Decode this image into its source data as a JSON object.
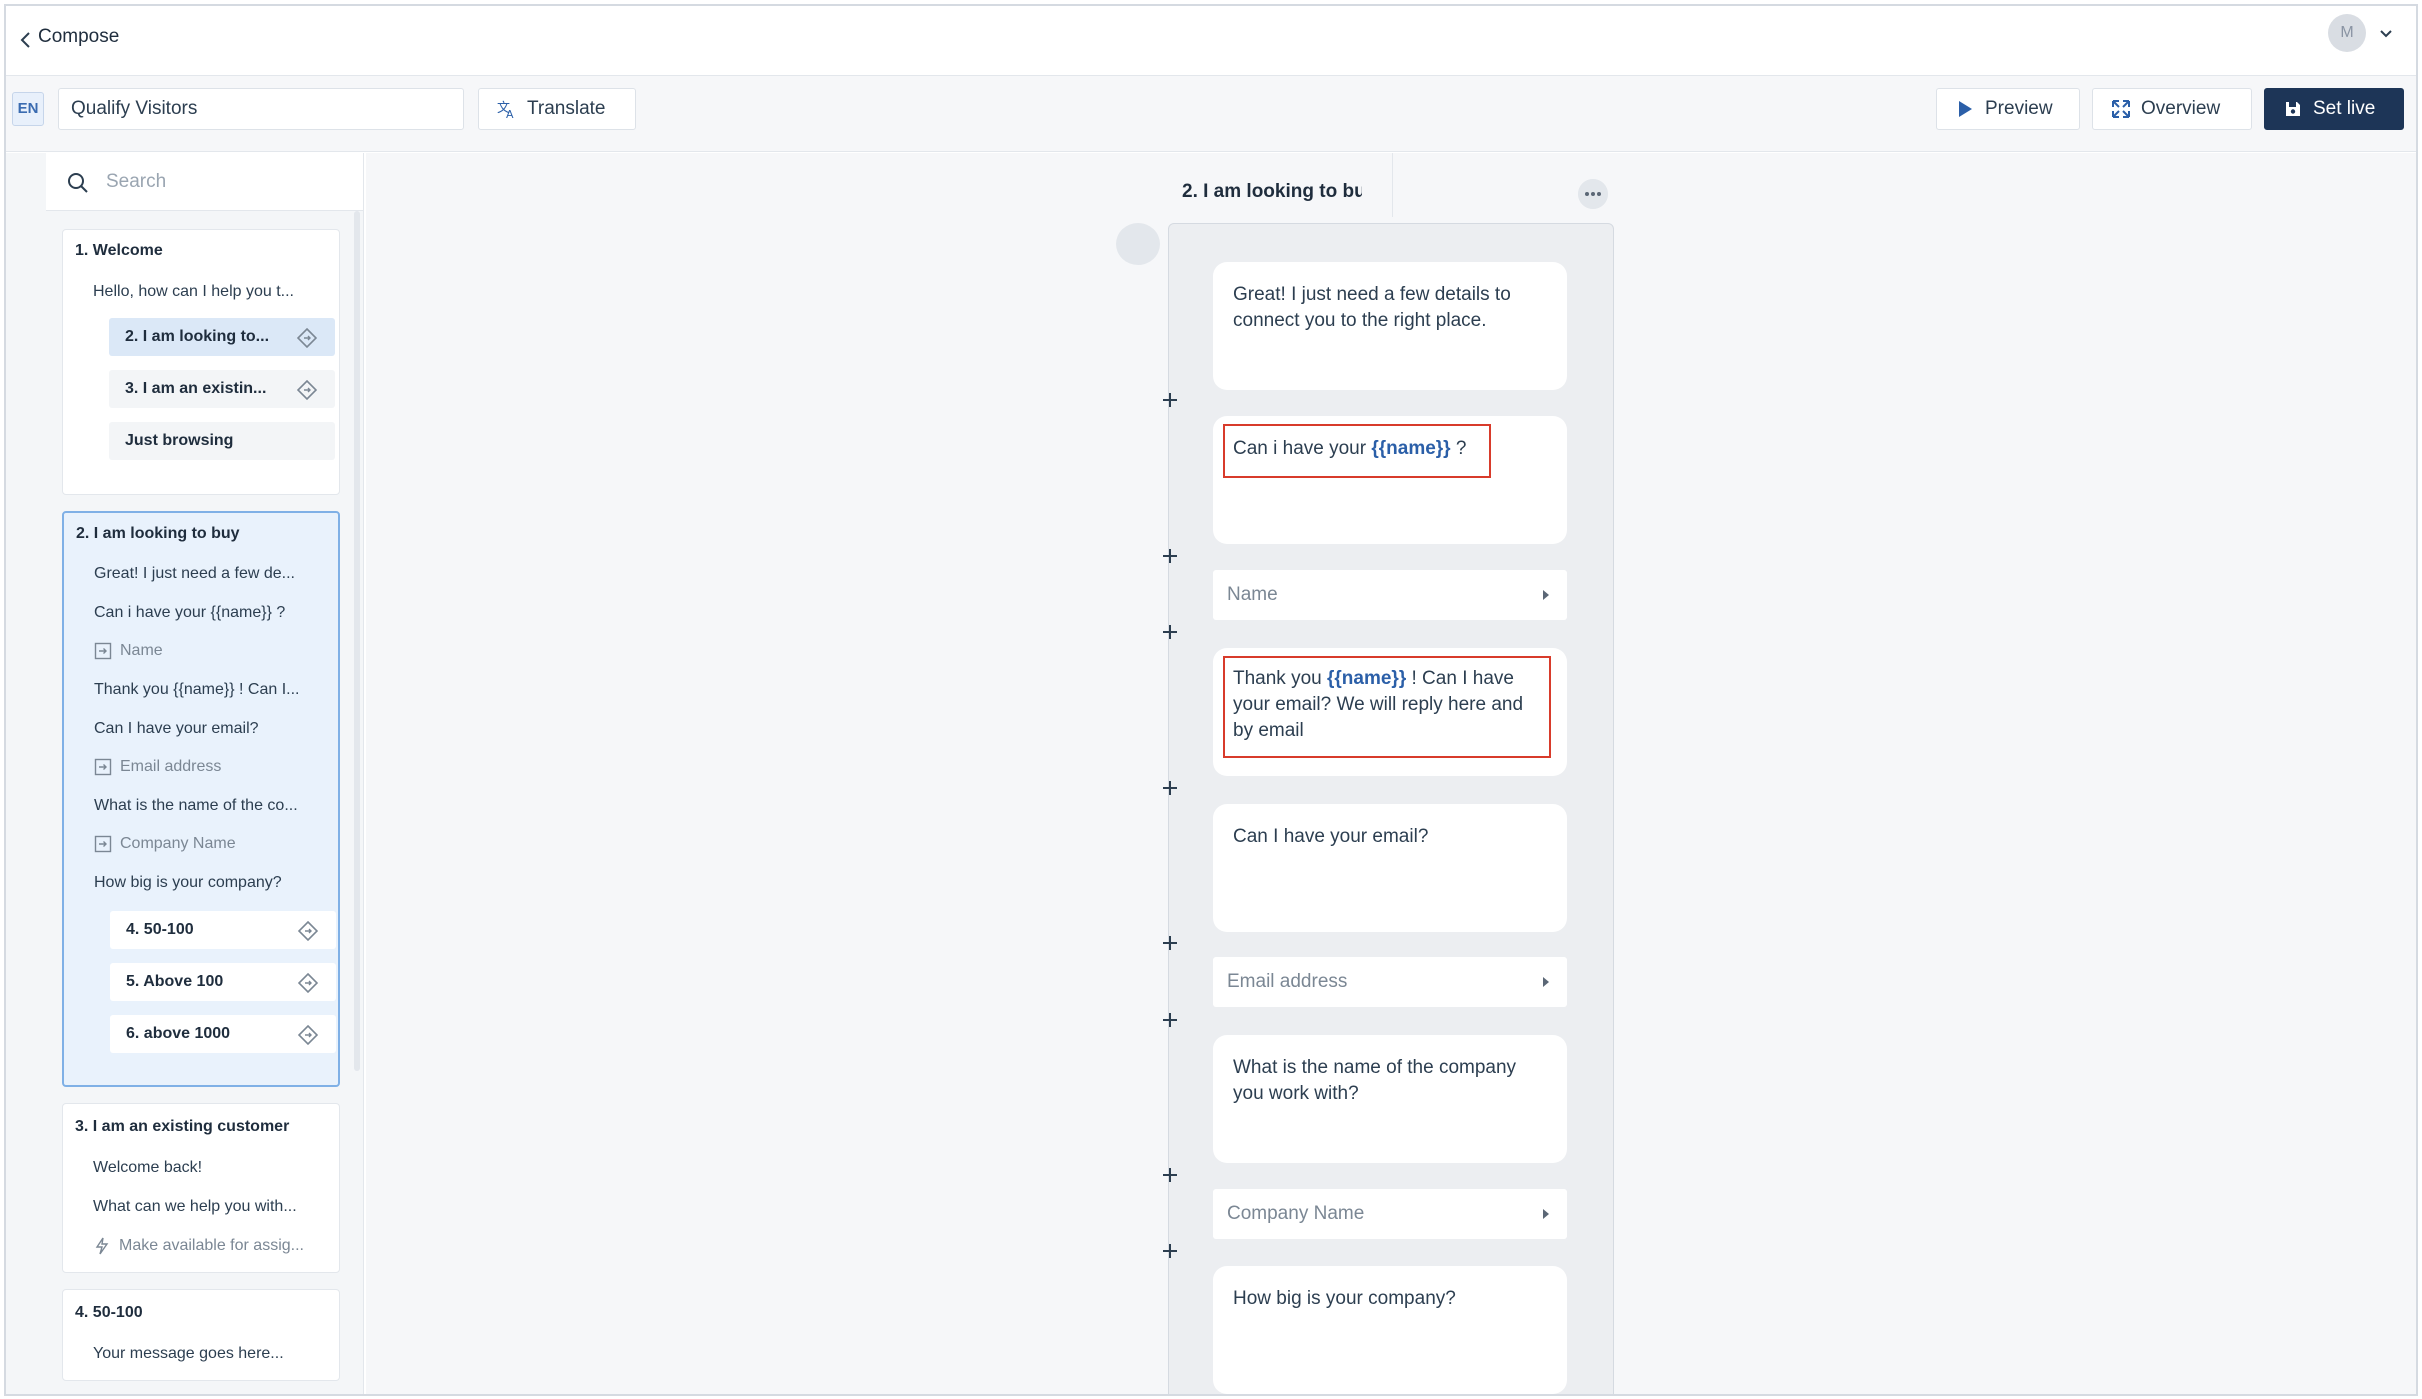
{
  "header": {
    "title": "Compose",
    "avatar_initial": "M"
  },
  "toolbar": {
    "language": "EN",
    "campaign_name": "Qualify Visitors",
    "translate_label": "Translate",
    "preview_label": "Preview",
    "overview_label": "Overview",
    "set_live_label": "Set live"
  },
  "sidebar": {
    "search_placeholder": "Search",
    "cards": [
      {
        "title": "1. Welcome",
        "lines": [
          "Hello, how can I help you t..."
        ],
        "options": [
          "2. I am looking to...",
          "3. I am an existin...",
          "Just browsing"
        ]
      },
      {
        "title": "2. I am looking to buy",
        "lines": [
          "Great! I just need a few de...",
          "Can i have your {{name}} ?",
          "Name",
          "Thank you {{name}} ! Can I...",
          "Can I have your email?",
          "Email address",
          "What is the name of the co...",
          "Company Name",
          "How big is your company?"
        ],
        "options": [
          "4. 50-100",
          "5. Above 100",
          "6. above 1000"
        ]
      },
      {
        "title": "3. I am an existing customer",
        "lines": [
          "Welcome back!",
          "What can we help you with...",
          "Make available for assig..."
        ]
      },
      {
        "title": "4. 50-100",
        "lines": [
          "Your message goes here..."
        ]
      }
    ]
  },
  "canvas": {
    "column_title": "2. I am looking to bu",
    "messages": [
      {
        "text": "Great! I just need a few details to connect you to the right place."
      },
      {
        "before": "Can i have your ",
        "var": "{{name}}",
        "after": " ?"
      },
      {
        "input": "Name"
      },
      {
        "before": "Thank you ",
        "var": "{{name}}",
        "after": " ! Can I have your email? We will reply here and by email"
      },
      {
        "text": "Can I have your email?"
      },
      {
        "input": "Email address"
      },
      {
        "text": "What is the name of the company you work with?"
      },
      {
        "input": "Company Name"
      },
      {
        "text": "How big is your company?"
      }
    ]
  },
  "colors": {
    "primary": "#1d3557",
    "accent": "#2b5fa8",
    "highlight_border": "#d83b2b",
    "active_card": "#e9f2fc"
  }
}
